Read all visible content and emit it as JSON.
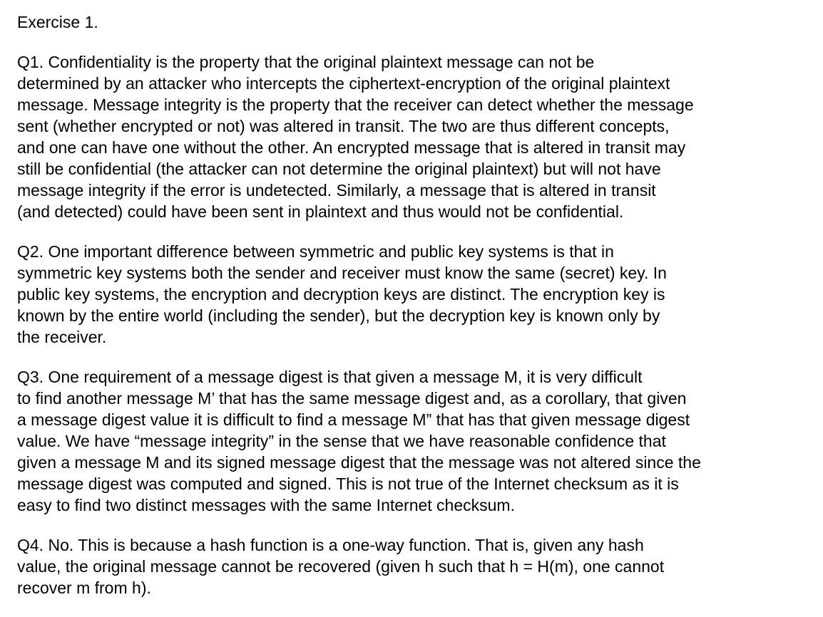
{
  "title": "Exercise 1.",
  "answers": [
    {
      "lines": [
        "Q1. Confidentiality is the property that the original plaintext message can not be",
        "determined by an attacker who intercepts the ciphertext-encryption of the original plaintext",
        "message. Message integrity is the property that the receiver can detect whether the message",
        "sent (whether encrypted or not) was altered in transit. The two are thus different concepts,",
        "and one can have one without the other. An encrypted message that is altered in transit may",
        "still be confidential (the attacker can not determine the original plaintext) but will not have",
        "message integrity if the error is undetected. Similarly, a message that is altered in transit",
        "(and detected) could have been sent in plaintext and thus would not be confidential."
      ]
    },
    {
      "lines": [
        "Q2. One important difference between symmetric and public key systems is that in",
        "symmetric key systems both the sender and receiver must know the same (secret) key. In",
        "public key systems, the encryption and decryption keys are distinct. The encryption key is",
        "known by the entire world (including the sender), but the decryption key is known only by",
        "the receiver."
      ]
    },
    {
      "lines": [
        "Q3. One requirement of a message digest is that given a message M, it is very difficult",
        "to find another message M’ that has the same message digest and, as a corollary, that given",
        "a message digest value it is difficult to find a message M” that has that given message digest",
        "value. We have “message integrity” in the sense that we have reasonable confidence that",
        "given a message M and its signed message digest that the message was not altered since the",
        "message digest was computed and signed. This is not true of the Internet checksum as it is",
        "easy to find two distinct messages with the same Internet checksum."
      ]
    },
    {
      "lines": [
        "Q4. No. This is because a hash function is a one-way function. That is, given any hash",
        "value, the original message cannot be recovered (given h such that h = H(m), one cannot",
        "recover m from h)."
      ]
    }
  ]
}
